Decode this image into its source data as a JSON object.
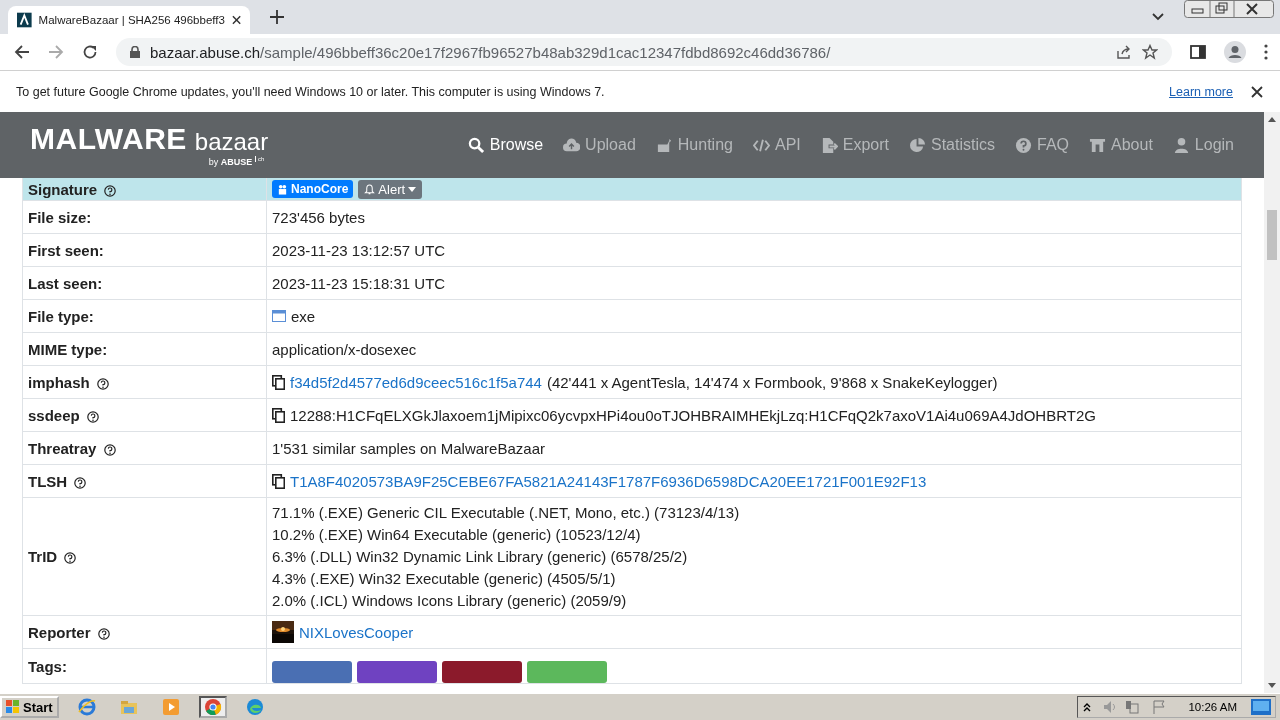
{
  "browser": {
    "tab_title": "MalwareBazaar | SHA256 496bbeff3",
    "url_host": "bazaar.abuse.ch",
    "url_path": "/sample/496bbeff36c20e17f2967fb96527b48ab329d1cac12347fdbd8692c46dd36786/"
  },
  "infobar": {
    "message": "To get future Google Chrome updates, you'll need Windows 10 or later. This computer is using Windows 7.",
    "link": "Learn more"
  },
  "site_header": {
    "logo_main": "MALWARE",
    "logo_sub": "bazaar",
    "logo_by": "by",
    "logo_org": "ABUSE",
    "logo_ch": "ch",
    "nav": [
      {
        "label": "Browse",
        "kind": "search",
        "selected": true
      },
      {
        "label": "Upload",
        "kind": "upload",
        "selected": false
      },
      {
        "label": "Hunting",
        "kind": "hunting",
        "selected": false
      },
      {
        "label": "API",
        "kind": "code",
        "selected": false
      },
      {
        "label": "Export",
        "kind": "export",
        "selected": false
      },
      {
        "label": "Statistics",
        "kind": "pie",
        "selected": false
      },
      {
        "label": "FAQ",
        "kind": "question",
        "selected": false
      },
      {
        "label": "About",
        "kind": "about",
        "selected": false
      },
      {
        "label": "Login",
        "kind": "user",
        "selected": false
      }
    ]
  },
  "details": [
    {
      "kind": "signature",
      "label": "Signature",
      "help": true,
      "tag": "NanoCore",
      "button": "Alert"
    },
    {
      "kind": "text",
      "label": "File size:",
      "help": false,
      "value": "723'456 bytes"
    },
    {
      "kind": "text",
      "label": "First seen:",
      "help": false,
      "value": "2023-11-23 13:12:57 UTC"
    },
    {
      "kind": "text",
      "label": "Last seen:",
      "help": false,
      "value": "2023-11-23 15:18:31 UTC"
    },
    {
      "kind": "filetype",
      "label": "File type:",
      "help": false,
      "value": "exe"
    },
    {
      "kind": "text",
      "label": "MIME type:",
      "help": false,
      "value": "application/x-dosexec"
    },
    {
      "kind": "hash",
      "label": "imphash",
      "help": true,
      "linked": true,
      "value": "f34d5f2d4577ed6d9ceec516c1f5a744",
      "note": "(42'441 x AgentTesla, 14'474 x Formbook, 9'868 x SnakeKeylogger)"
    },
    {
      "kind": "hash",
      "label": "ssdeep",
      "help": true,
      "linked": false,
      "value": "12288:H1CFqELXGkJlaxoem1jMipixc06ycvpxHPi4ou0oTJOHBRAIMHEkjLzq:H1CFqQ2k7axoV1Ai4u069A4JdOHBRT2G"
    },
    {
      "kind": "text",
      "label": "Threatray",
      "help": true,
      "value": "1'531 similar samples on MalwareBazaar"
    },
    {
      "kind": "hash",
      "label": "TLSH",
      "help": true,
      "linked": true,
      "value": "T1A8F4020573BA9F25CEBE67FA5821A24143F1787F6936D6598DCA20EE1721F001E92F13"
    },
    {
      "kind": "lines",
      "label": "TrID",
      "help": true,
      "lines": [
        "71.1% (.EXE) Generic CIL Executable (.NET, Mono, etc.) (73123/4/13)",
        "10.2% (.EXE) Win64 Executable (generic) (10523/12/4)",
        "6.3% (.DLL) Win32 Dynamic Link Library (generic) (6578/25/2)",
        "4.3% (.EXE) Win32 Executable (generic) (4505/5/1)",
        "2.0% (.ICL) Windows Icons Library (generic) (2059/9)"
      ]
    },
    {
      "kind": "reporter",
      "label": "Reporter",
      "help": true,
      "value": "NIXLovesCooper"
    },
    {
      "kind": "tags",
      "label": "Tags:",
      "help": false,
      "tags": [
        {
          "color": "#4a6fb3"
        },
        {
          "color": "#6f42c1"
        },
        {
          "color": "#8b1a2b"
        },
        {
          "color": "#5cb85c"
        }
      ]
    }
  ],
  "taskbar": {
    "start": "Start",
    "apps": [
      {
        "kind": "ie",
        "selected": false
      },
      {
        "kind": "folder",
        "selected": false
      },
      {
        "kind": "media",
        "selected": false
      },
      {
        "kind": "chrome",
        "selected": true
      },
      {
        "kind": "edge",
        "selected": false
      }
    ],
    "time": "10:26 AM"
  }
}
